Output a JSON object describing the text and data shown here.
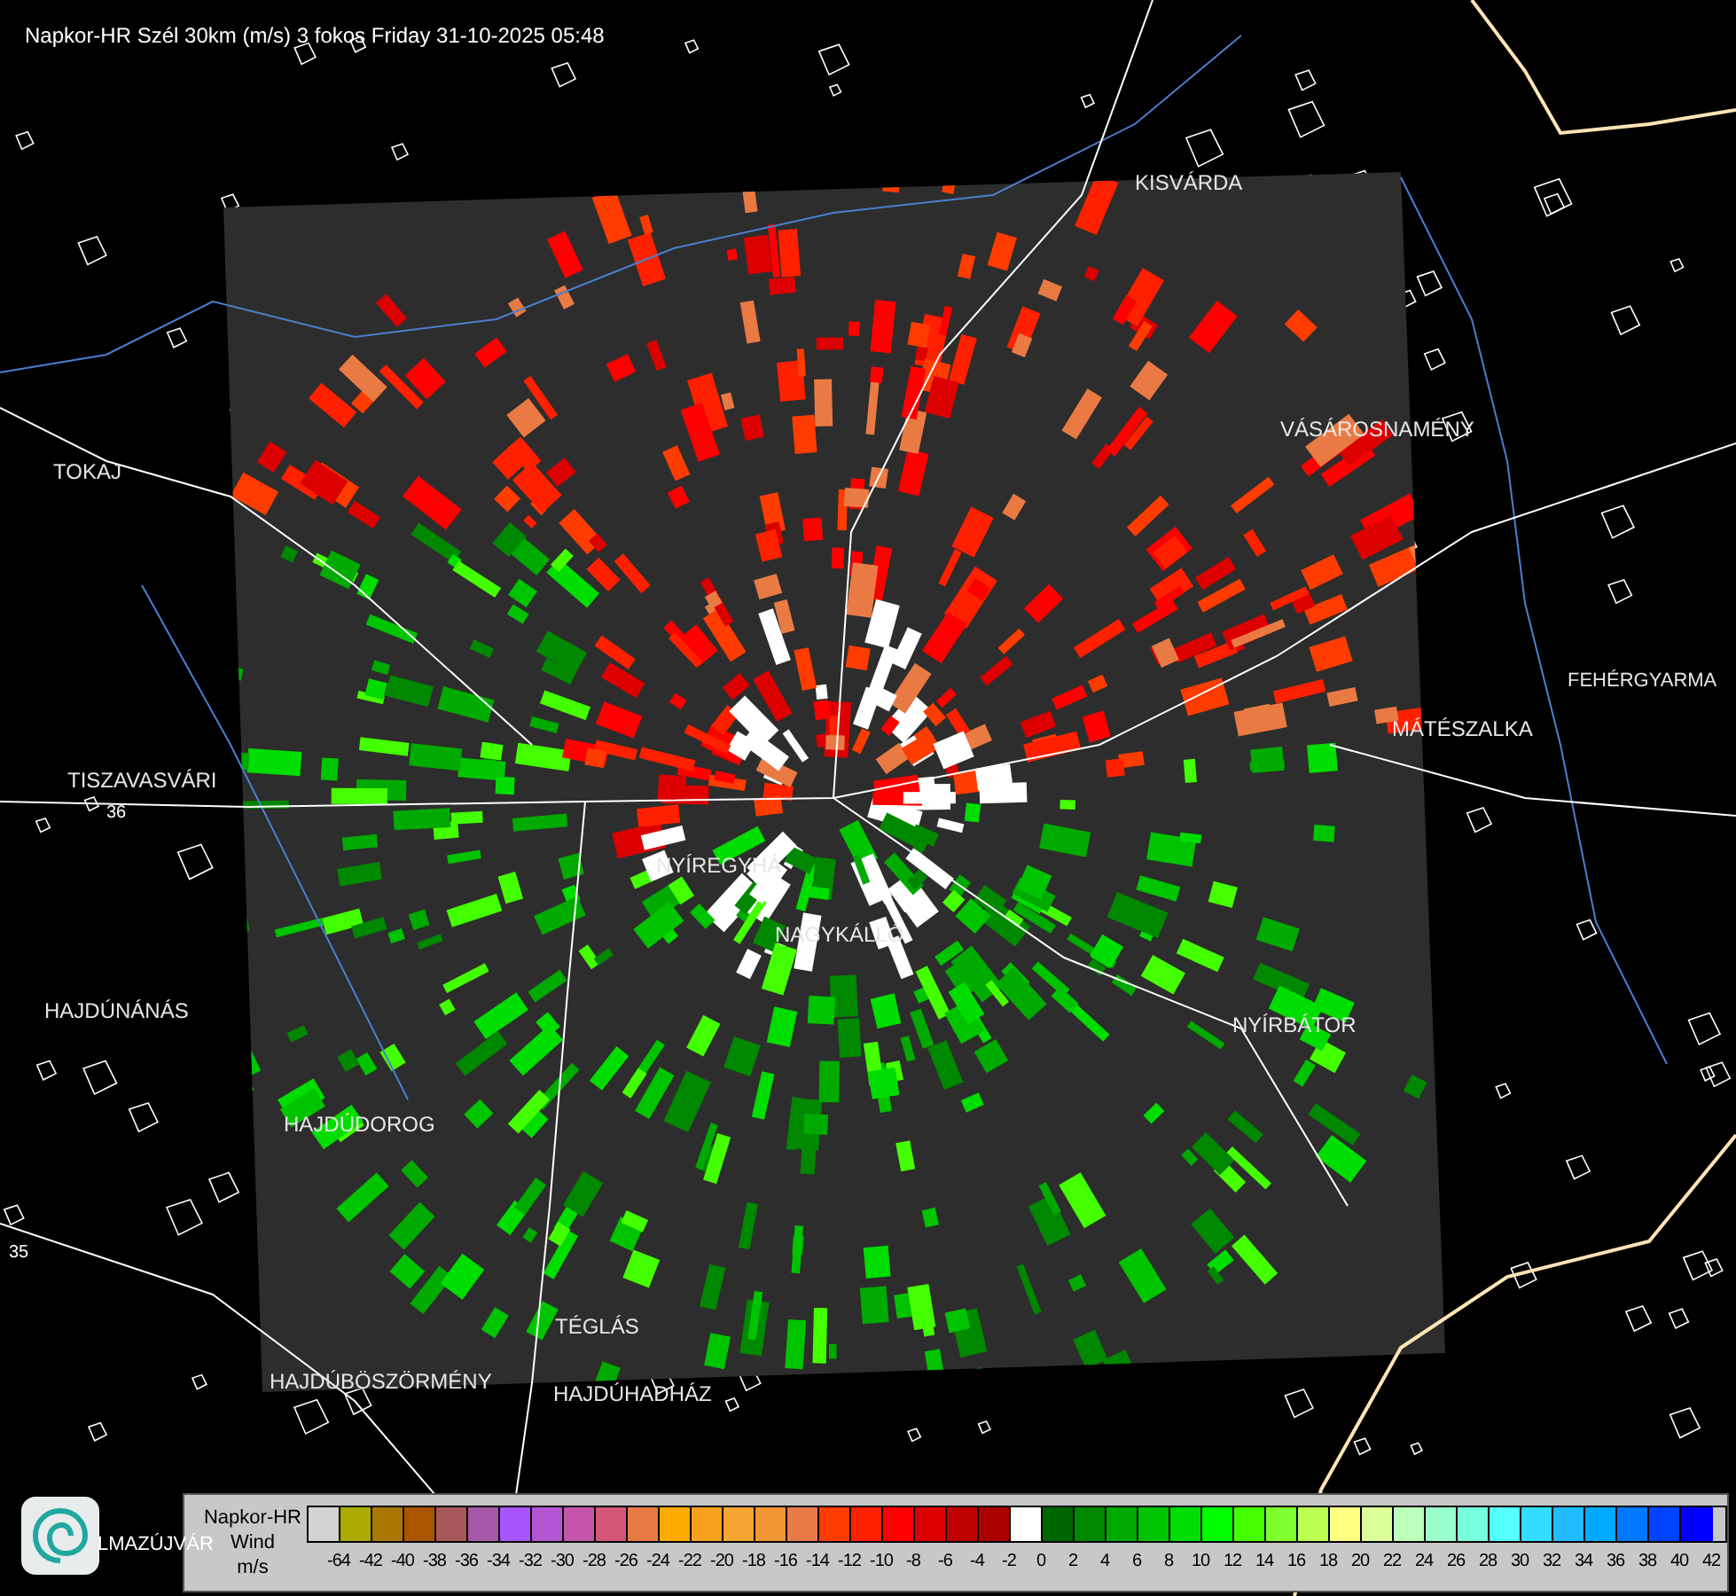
{
  "title": "Napkor-HR Szél 30km (m/s) 3 fokos Friday 31-10-2025 05:48",
  "map_labels": [
    {
      "text": "KISVÁRDA",
      "kind": "city"
    },
    {
      "text": "VÁSÁROSNAMÉNY",
      "kind": "city"
    },
    {
      "text": "TOKAJ",
      "kind": "city"
    },
    {
      "text": "FEHÉRGYARMA",
      "kind": "city"
    },
    {
      "text": "MÁTÉSZALKA",
      "kind": "city"
    },
    {
      "text": "TISZAVASVÁRI",
      "kind": "city"
    },
    {
      "text": "36",
      "kind": "road"
    },
    {
      "text": "NYÍREGYHÁ",
      "kind": "city"
    },
    {
      "text": "NAGYKÁLLÓ",
      "kind": "city"
    },
    {
      "text": "HAJDÚNÁNÁS",
      "kind": "city"
    },
    {
      "text": "NYÍRBÁTOR",
      "kind": "city"
    },
    {
      "text": "HAJDÚDOROG",
      "kind": "city"
    },
    {
      "text": "35",
      "kind": "road"
    },
    {
      "text": "TÉGLÁS",
      "kind": "city"
    },
    {
      "text": "HAJDÚBÖSZÖRMÉNY",
      "kind": "city"
    },
    {
      "text": "HAJDÚHADHÁZ",
      "kind": "city"
    },
    {
      "text": "LMAZÚJVÁR",
      "kind": "city"
    }
  ],
  "legend": {
    "lines": [
      "Napkor-HR",
      "Wind",
      "m/s"
    ],
    "items": [
      {
        "color": "#d3d3d3",
        "label": "-64"
      },
      {
        "color": "#aaaa00",
        "label": "-42"
      },
      {
        "color": "#aa7700",
        "label": "-40"
      },
      {
        "color": "#aa5500",
        "label": "-38"
      },
      {
        "color": "#a85858",
        "label": "-36"
      },
      {
        "color": "#a858a8",
        "label": "-34"
      },
      {
        "color": "#a855ff",
        "label": "-32"
      },
      {
        "color": "#b455d4",
        "label": "-30"
      },
      {
        "color": "#c455aa",
        "label": "-28"
      },
      {
        "color": "#d45577",
        "label": "-26"
      },
      {
        "color": "#ea7a44",
        "label": "-24"
      },
      {
        "color": "#ffaa00",
        "label": "-22"
      },
      {
        "color": "#f5a01e",
        "label": "-20"
      },
      {
        "color": "#f5a532",
        "label": "-18"
      },
      {
        "color": "#f09632",
        "label": "-16"
      },
      {
        "color": "#ea7a48",
        "label": "-14"
      },
      {
        "color": "#ff3c00",
        "label": "-12"
      },
      {
        "color": "#ff2000",
        "label": "-10"
      },
      {
        "color": "#ff0000",
        "label": "-8"
      },
      {
        "color": "#dd0000",
        "label": "-6"
      },
      {
        "color": "#c00000",
        "label": "-4"
      },
      {
        "color": "#aa0000",
        "label": "-2"
      },
      {
        "color": "#ffffff",
        "label": "0"
      },
      {
        "color": "#006600",
        "label": "2"
      },
      {
        "color": "#008800",
        "label": "4"
      },
      {
        "color": "#00aa00",
        "label": "6"
      },
      {
        "color": "#00c400",
        "label": "8"
      },
      {
        "color": "#00dd00",
        "label": "10"
      },
      {
        "color": "#00ff00",
        "label": "12"
      },
      {
        "color": "#44ff00",
        "label": "14"
      },
      {
        "color": "#80ff30",
        "label": "16"
      },
      {
        "color": "#bbff55",
        "label": "18"
      },
      {
        "color": "#ffff80",
        "label": "20"
      },
      {
        "color": "#ddff99",
        "label": "22"
      },
      {
        "color": "#bbffbb",
        "label": "24"
      },
      {
        "color": "#99ffcc",
        "label": "26"
      },
      {
        "color": "#77ffdd",
        "label": "28"
      },
      {
        "color": "#55ffff",
        "label": "30"
      },
      {
        "color": "#33ddff",
        "label": "32"
      },
      {
        "color": "#22bbff",
        "label": "34"
      },
      {
        "color": "#00aaff",
        "label": "36"
      },
      {
        "color": "#0077ff",
        "label": "38"
      },
      {
        "color": "#0044ff",
        "label": "40"
      },
      {
        "color": "#0000ff",
        "label": "42"
      }
    ]
  }
}
